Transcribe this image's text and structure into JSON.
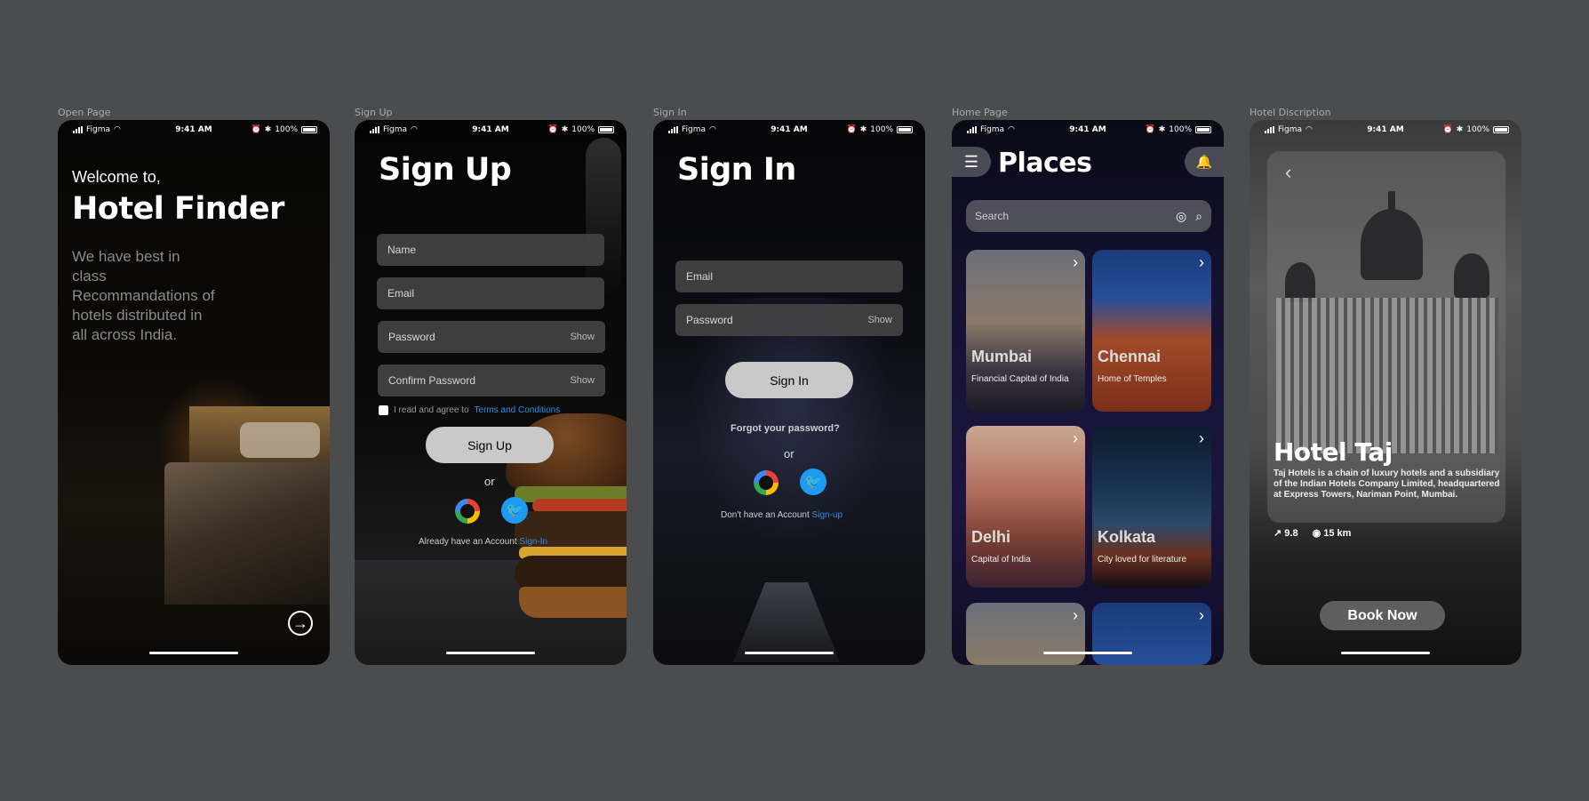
{
  "frames": {
    "open": "Open Page",
    "signup": "Sign Up",
    "signin": "Sign In",
    "home": "Home Page",
    "hotel": "Hotel Discription"
  },
  "status": {
    "carrier": "Figma",
    "time": "9:41 AM",
    "battery": "100%"
  },
  "open_page": {
    "welcome": "Welcome to,",
    "title": "Hotel Finder",
    "description": "We have best in class Recommandations of hotels distributed in all across India.",
    "next_icon": "arrow-right-circle-icon"
  },
  "signup_page": {
    "title": "Sign Up",
    "name_placeholder": "Name",
    "email_placeholder": "Email",
    "password_placeholder": "Password",
    "confirm_placeholder": "Confirm Password",
    "show": "Show",
    "agree_text": "I read and agree to",
    "terms": "Terms and Conditions",
    "button": "Sign Up",
    "or": "or",
    "already": "Already have an Account",
    "signin_link": "Sign-In"
  },
  "signin_page": {
    "title": "Sign In",
    "email_placeholder": "Email",
    "password_placeholder": "Password",
    "show": "Show",
    "button": "Sign In",
    "forgot": "Forgot your password?",
    "or": "or",
    "no_account": "Don't have an Account",
    "signup_link": "Sign-up"
  },
  "home_page": {
    "title": "Places",
    "search_placeholder": "Search",
    "places": [
      {
        "name": "Mumbai",
        "subtitle": "Financial Capital of India"
      },
      {
        "name": "Chennai",
        "subtitle": "Home of Temples"
      },
      {
        "name": "Delhi",
        "subtitle": "Capital of India"
      },
      {
        "name": "Kolkata",
        "subtitle": "City loved for literature"
      }
    ]
  },
  "hotel_page": {
    "name": "Hotel Taj",
    "description": "Taj Hotels is a chain of luxury hotels and a subsidiary of the Indian Hotels Company Limited, headquartered at Express Towers, Nariman Point, Mumbai.",
    "rating": "9.8",
    "distance": "15 km",
    "book": "Book Now"
  },
  "colors": {
    "background": "#4b4c4e",
    "link": "#2f8fe0",
    "twitter": "#1d9bf0"
  }
}
